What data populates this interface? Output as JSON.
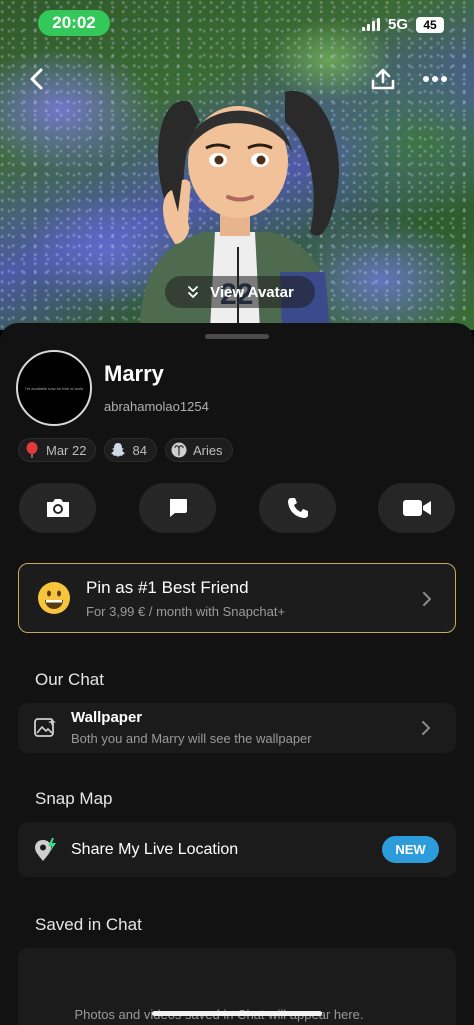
{
  "status_bar": {
    "time": "20:02",
    "network": "5G",
    "battery": "45"
  },
  "hero": {
    "view_avatar_label": "View Avatar"
  },
  "profile": {
    "name": "Marry",
    "username": "abrahamolao1254",
    "pic_caption": "I'm available now for free ai tools",
    "chips": [
      {
        "icon": "balloon-icon",
        "label": "Mar 22"
      },
      {
        "icon": "snapscore-icon",
        "label": "84"
      },
      {
        "icon": "aries-icon",
        "label": "Aries"
      }
    ]
  },
  "pin": {
    "title": "Pin as #1 Best Friend",
    "subtitle": "For 3,99 € / month with Snapchat+"
  },
  "our_chat": {
    "title": "Our Chat",
    "wallpaper_title": "Wallpaper",
    "wallpaper_sub": "Both you and Marry will see the wallpaper"
  },
  "snap_map": {
    "title": "Snap Map",
    "share_location": "Share My Live Location",
    "badge": "NEW"
  },
  "saved": {
    "title": "Saved in Chat",
    "empty_text": "Photos and videos saved in Chat will appear here."
  },
  "colors": {
    "accent_gold": "#c9a85a",
    "badge_blue": "#2d9cdb",
    "status_green": "#34c759"
  }
}
